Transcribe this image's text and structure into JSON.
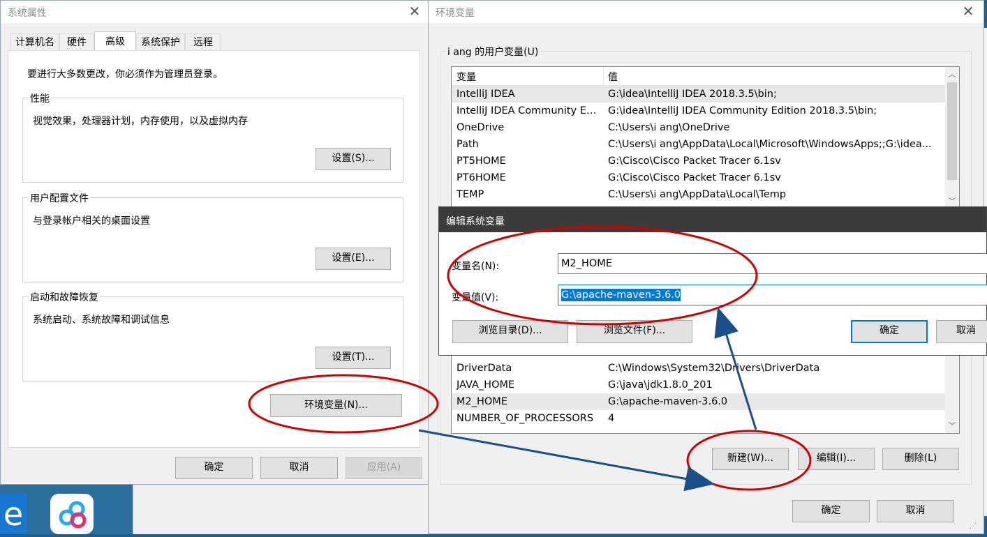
{
  "sys_props": {
    "title": "系统属性",
    "tabs": [
      "计算机名",
      "硬件",
      "高级",
      "系统保护",
      "远程"
    ],
    "admin_note": "要进行大多数更改，你必须作为管理员登录。",
    "performance": {
      "title": "性能",
      "desc": "视觉效果，处理器计划，内存使用，以及虚拟内存",
      "button": "设置(S)..."
    },
    "user_profile": {
      "title": "用户配置文件",
      "desc": "与登录帐户相关的桌面设置",
      "button": "设置(E)..."
    },
    "startup": {
      "title": "启动和故障恢复",
      "desc": "系统启动、系统故障和调试信息",
      "button": "设置(T)..."
    },
    "env_button": "环境变量(N)...",
    "ok": "确定",
    "cancel": "取消",
    "apply": "应用(A)"
  },
  "env_vars": {
    "title": "环境变量",
    "user_group_title": "i ang 的用户变量(U)",
    "col_var": "变量",
    "col_val": "值",
    "user_rows": [
      {
        "name": "IntelliJ IDEA",
        "value": "G:\\idea\\IntelliJ IDEA 2018.3.5\\bin;"
      },
      {
        "name": "IntelliJ IDEA Community Ed...",
        "value": "G:\\idea\\IntelliJ IDEA Community Edition 2018.3.5\\bin;"
      },
      {
        "name": "OneDrive",
        "value": "C:\\Users\\i ang\\OneDrive"
      },
      {
        "name": "Path",
        "value": "C:\\Users\\i ang\\AppData\\Local\\Microsoft\\WindowsApps;;G:\\idea..."
      },
      {
        "name": "PT5HOME",
        "value": "G:\\Cisco\\Cisco Packet Tracer 6.1sv"
      },
      {
        "name": "PT6HOME",
        "value": "G:\\Cisco\\Cisco Packet Tracer 6.1sv"
      },
      {
        "name": "TEMP",
        "value": "C:\\Users\\i ang\\AppData\\Local\\Temp"
      }
    ],
    "system_rows": [
      {
        "name": "DriverData",
        "value": "C:\\Windows\\System32\\Drivers\\DriverData"
      },
      {
        "name": "JAVA_HOME",
        "value": "G:\\java\\jdk1.8.0_201"
      },
      {
        "name": "M2_HOME",
        "value": "G:\\apache-maven-3.6.0"
      },
      {
        "name": "NUMBER_OF_PROCESSORS",
        "value": "4"
      }
    ],
    "new_button": "新建(W)...",
    "edit_button": "编辑(I)...",
    "delete_button": "删除(L)",
    "ok": "确定",
    "cancel": "取消"
  },
  "edit_dialog": {
    "title": "编辑系统变量",
    "name_label": "变量名(N):",
    "name_value": "M2_HOME",
    "value_label": "变量值(V):",
    "value_value": "G:\\apache-maven-3.6.0",
    "browse_dir": "浏览目录(D)...",
    "browse_file": "浏览文件(F)...",
    "ok": "确定",
    "cancel": "取消"
  },
  "colors": {
    "annotation_ellipse": "#d10000",
    "annotation_arrow": "#1a4f8a",
    "focus_blue": "#0078d7"
  }
}
